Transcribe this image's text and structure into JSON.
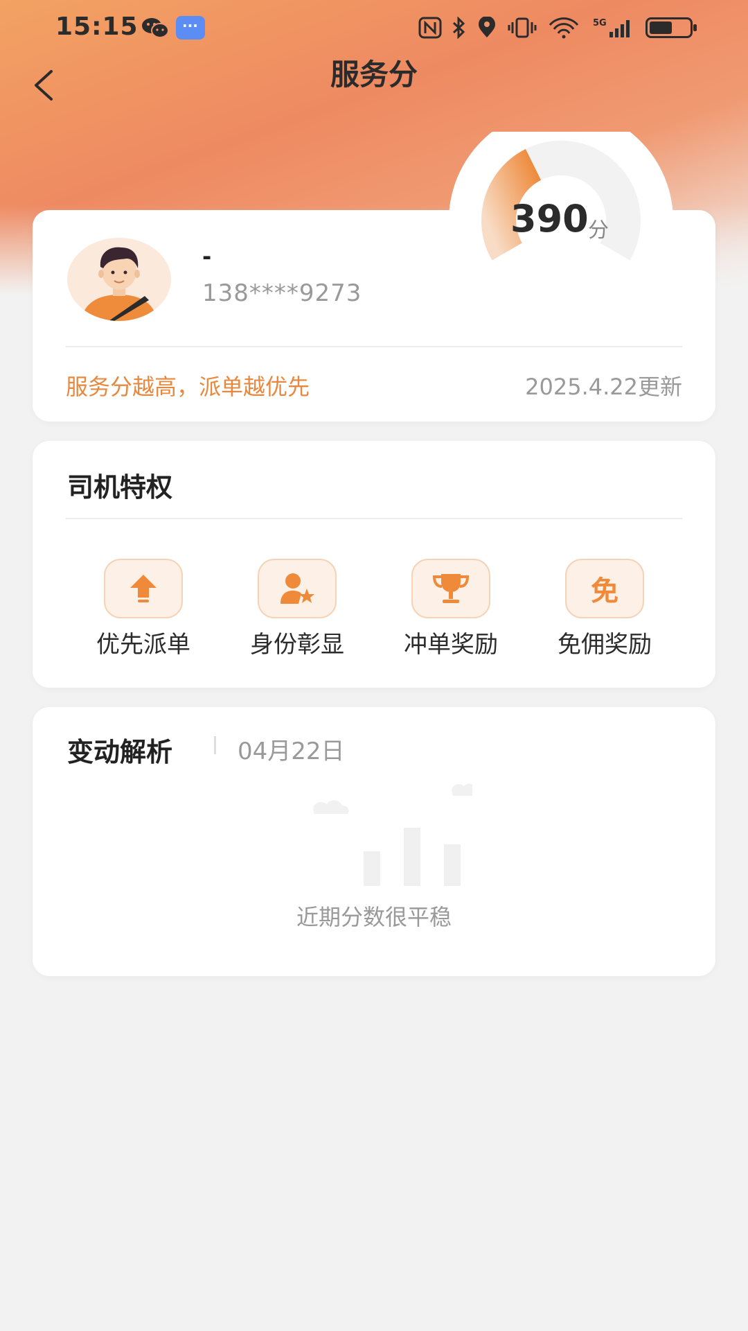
{
  "status_bar": {
    "time": "15:15"
  },
  "nav": {
    "title": "服务分"
  },
  "profile": {
    "name": "-",
    "phone": "138****9273",
    "tip": "服务分越高，派单越优先",
    "update": "2025.4.22更新",
    "score": "390",
    "score_unit": "分",
    "score_fill_fraction": 0.39
  },
  "privileges": {
    "title": "司机特权",
    "items": [
      {
        "label": "优先派单",
        "icon": "arrow-up-icon"
      },
      {
        "label": "身份彰显",
        "icon": "person-star-icon"
      },
      {
        "label": "冲单奖励",
        "icon": "trophy-icon"
      },
      {
        "label": "免佣奖励",
        "icon": "mian-badge-icon",
        "glyph": "免"
      }
    ]
  },
  "change": {
    "title": "变动解析",
    "date": "04月22日",
    "empty_text": "近期分数很平稳"
  },
  "colors": {
    "accent": "#E8883F",
    "header_start": "#F3A263",
    "header_end": "#EE8A62"
  }
}
